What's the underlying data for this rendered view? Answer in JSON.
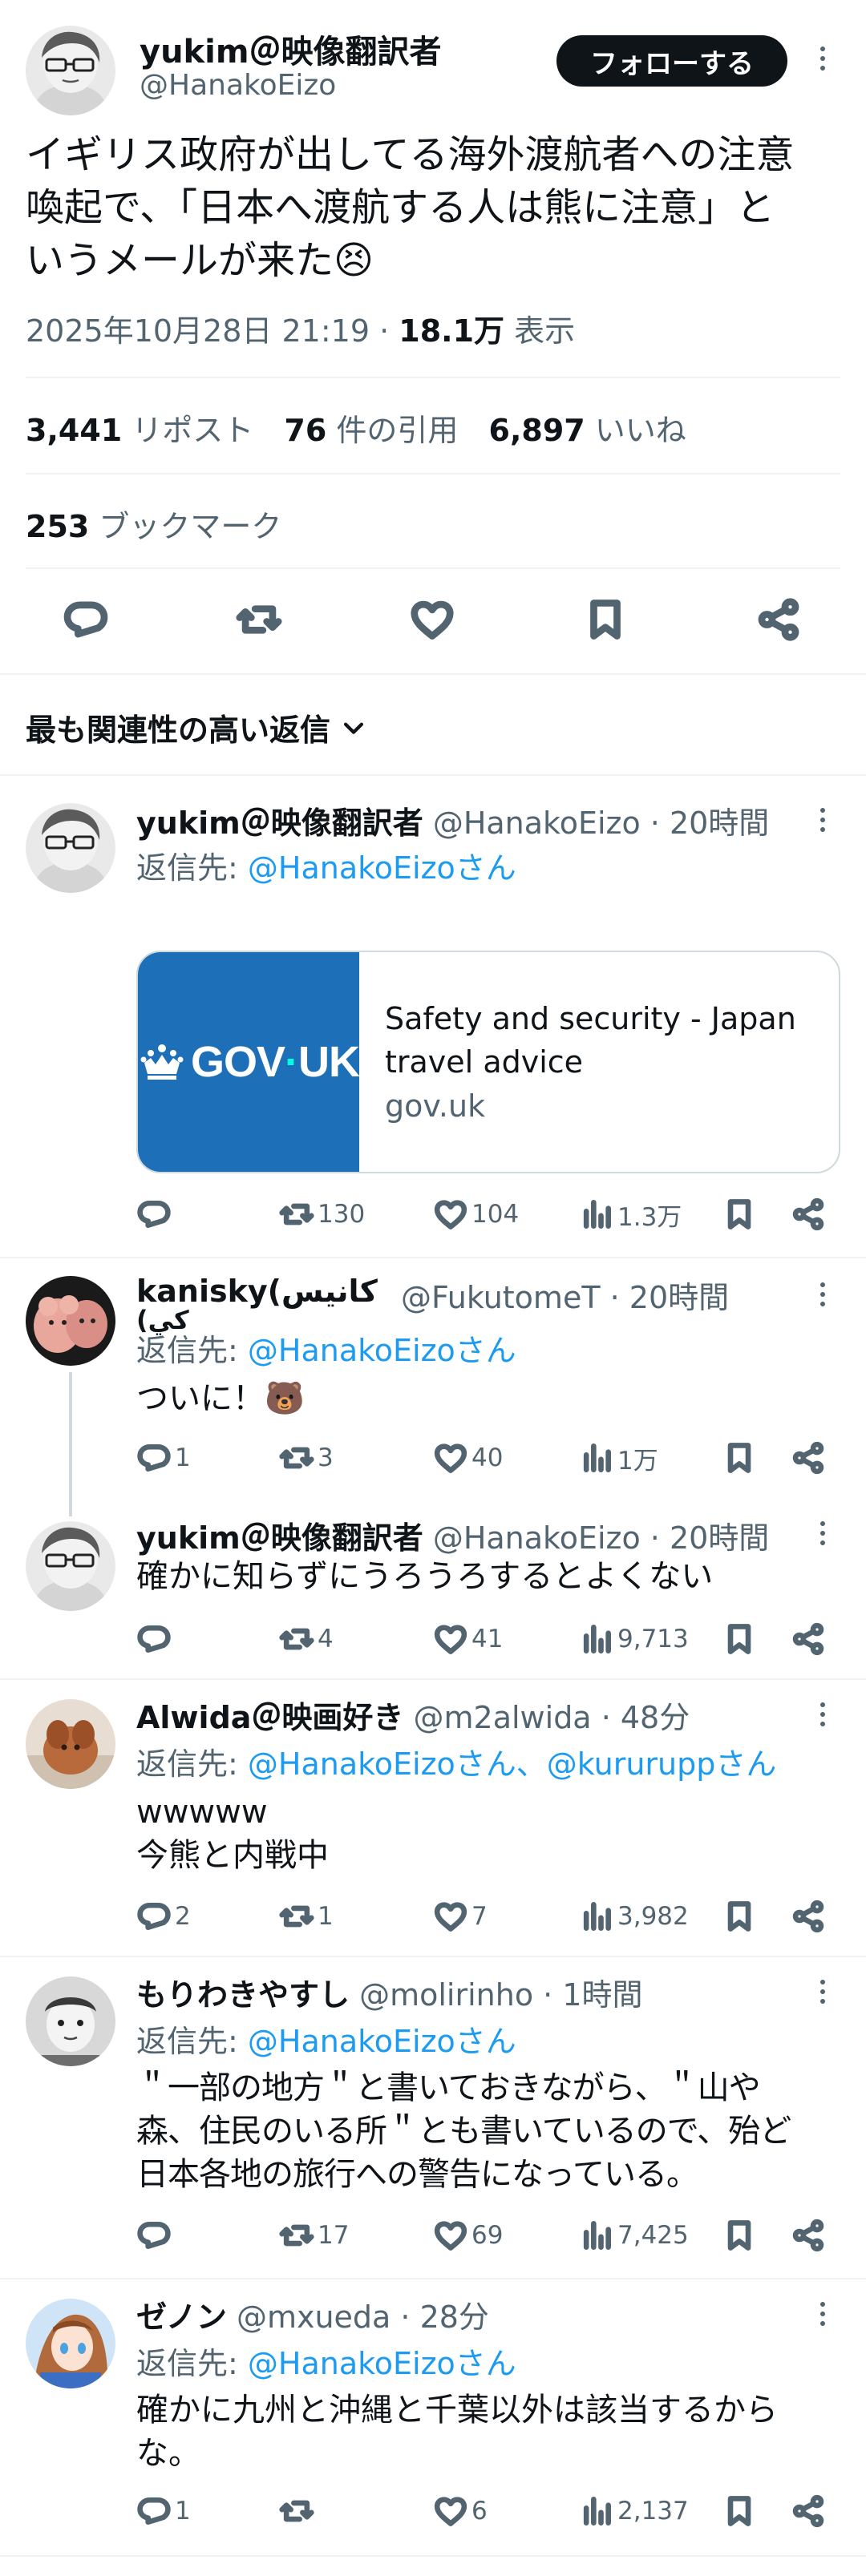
{
  "main_tweet": {
    "author_name": "yukim＠映像翻訳者",
    "author_handle": "@HanakoEizo",
    "follow_label": "フォローする",
    "text_line1": "イギリス政府が出してる海外渡航者への注意",
    "text_line2": "喚起で、「日本へ渡航する人は熊に注意」と",
    "text_line3": "いうメールが来た",
    "emoji": "😣",
    "timestamp": "2025年10月28日 21:19 · ",
    "views_count": "18.1万",
    "views_label": " 表示",
    "reposts_count": "3,441",
    "reposts_label": "リポスト",
    "quotes_count": "76",
    "quotes_label": "件の引用",
    "likes_count": "6,897",
    "likes_label": "いいね",
    "bookmarks_count": "253",
    "bookmarks_label": "ブックマーク"
  },
  "sort_label": "最も関連性の高い返信",
  "replies": [
    {
      "name": "yukim＠映像翻訳者",
      "handle": "@HanakoEizo",
      "time": " · 20時間",
      "reply_to_label": "返信先: ",
      "reply_to": "@HanakoEizoさん",
      "card": {
        "logo_text": "GOV",
        "logo_dot": "·",
        "logo_text2": "UK",
        "title_line1": "Safety and security - Japan",
        "title_line2": "travel advice",
        "domain": "gov.uk"
      },
      "stats": {
        "replies": "",
        "reposts": "130",
        "likes": "104",
        "views": "1.3万"
      }
    },
    {
      "name": "kanisky(كانيس",
      "name_line2": "كي)",
      "handle": "@FukutomeT",
      "time": " · 20時間",
      "reply_to_label": "返信先: ",
      "reply_to": "@HanakoEizoさん",
      "text": "ついに！",
      "emoji": "🐻",
      "stats": {
        "replies": "1",
        "reposts": "3",
        "likes": "40",
        "views": "1万"
      }
    },
    {
      "name": "yukim＠映像翻訳者",
      "handle": "@HanakoEizo",
      "time": " · 20時間",
      "text": "確かに知らずにうろうろするとよくない",
      "stats": {
        "replies": "",
        "reposts": "4",
        "likes": "41",
        "views": "9,713"
      }
    },
    {
      "name": "Alwida＠映画好き",
      "handle": "@m2alwida",
      "time": " · 48分",
      "reply_to_label": "返信先: ",
      "reply_to": "@HanakoEizoさん、@kururuppさん",
      "text_line1": "wwwww",
      "text_line2": "今熊と内戦中",
      "stats": {
        "replies": "2",
        "reposts": "1",
        "likes": "7",
        "views": "3,982"
      }
    },
    {
      "name": "もりわきやすし",
      "handle": "@molirinho",
      "time": " · 1時間",
      "reply_to_label": "返信先: ",
      "reply_to": "@HanakoEizoさん",
      "text_line1": "＂一部の地方＂と書いておきながら、＂山や",
      "text_line2": "森、住民のいる所＂とも書いているので、殆ど",
      "text_line3": "日本各地の旅行への警告になっている。",
      "stats": {
        "replies": "",
        "reposts": "17",
        "likes": "69",
        "views": "7,425"
      }
    },
    {
      "name": "ゼノン",
      "handle": "@mxueda",
      "time": " · 28分",
      "reply_to_label": "返信先: ",
      "reply_to": "@HanakoEizoさん",
      "text_line1": "確かに九州と沖縄と千葉以外は該当するから",
      "text_line2": "な。",
      "stats": {
        "replies": "1",
        "reposts": "",
        "likes": "6",
        "views": "2,137"
      }
    }
  ],
  "colors": {
    "accent": "#1d9bf0",
    "text": "#0f1419",
    "muted": "#536471",
    "gov_blue": "#1d70b8"
  }
}
